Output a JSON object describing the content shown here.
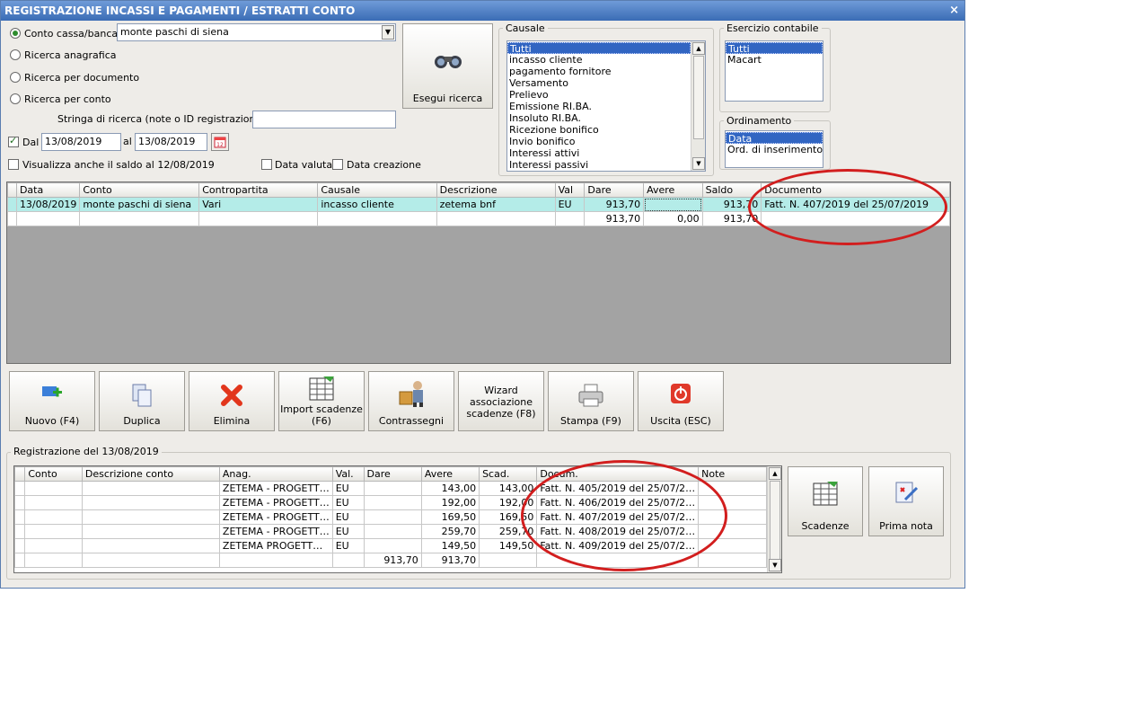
{
  "window": {
    "title": "REGISTRAZIONE INCASSI E PAGAMENTI / ESTRATTI CONTO",
    "close": "×"
  },
  "search": {
    "radio_conto": "Conto cassa/banca",
    "conto_value": "monte paschi di siena",
    "radio_anagrafica": "Ricerca anagrafica",
    "radio_documento": "Ricerca per documento",
    "radio_perconto": "Ricerca per conto",
    "stringa_label": "Stringa di ricerca (note o ID registrazione) :",
    "stringa_value": "",
    "dal_label": "Dal",
    "dal_value": "13/08/2019",
    "al_label": "al",
    "al_value": "13/08/2019",
    "saldo_label": "Visualizza anche il saldo al 12/08/2019",
    "data_valuta": "Data valuta",
    "data_creazione": "Data creazione",
    "esegui": "Esegui ricerca"
  },
  "causale": {
    "title": "Causale",
    "items": [
      "Tutti",
      "incasso cliente",
      "pagamento fornitore",
      "Versamento",
      "Prelievo",
      "Emissione RI.BA.",
      "Insoluto RI.BA.",
      "Ricezione bonifico",
      "Invio bonifico",
      "Interessi attivi",
      "Interessi passivi"
    ]
  },
  "esercizio": {
    "title": "Esercizio contabile",
    "items": [
      "Tutti",
      "Macart"
    ]
  },
  "ordinamento": {
    "title": "Ordinamento",
    "items": [
      "Data",
      "Ord. di inserimento"
    ]
  },
  "main_grid": {
    "headers": [
      "Data",
      "Conto",
      "Contropartita",
      "Causale",
      "Descrizione",
      "Val",
      "Dare",
      "Avere",
      "Saldo",
      "Documento"
    ],
    "rows": [
      [
        "13/08/2019",
        "monte paschi di siena",
        "Vari",
        "incasso cliente",
        "zetema bnf",
        "EU",
        "913,70",
        "",
        "913,70",
        "Fatt. N. 407/2019 del 25/07/2019"
      ]
    ],
    "totals": [
      "",
      "",
      "",
      "",
      "",
      "",
      "913,70",
      "0,00",
      "913,70",
      ""
    ]
  },
  "toolbar": {
    "nuovo": "Nuovo (F4)",
    "duplica": "Duplica",
    "elimina": "Elimina",
    "import": "Import scadenze (F6)",
    "contrassegni": "Contrassegni",
    "wizard": "Wizard associazione scadenze (F8)",
    "stampa": "Stampa (F9)",
    "uscita": "Uscita (ESC)"
  },
  "detail": {
    "title": "Registrazione del 13/08/2019",
    "headers": [
      "Conto",
      "Descrizione conto",
      "Anag.",
      "Val.",
      "Dare",
      "Avere",
      "Scad.",
      "Docum.",
      "Note"
    ],
    "rows": [
      [
        "",
        "",
        "ZETEMA - PROGETT…",
        "EU",
        "",
        "143,00",
        "143,00",
        "Fatt. N. 405/2019 del 25/07/2…",
        ""
      ],
      [
        "",
        "",
        "ZETEMA - PROGETT…",
        "EU",
        "",
        "192,00",
        "192,00",
        "Fatt. N. 406/2019 del 25/07/2…",
        ""
      ],
      [
        "",
        "",
        "ZETEMA - PROGETT…",
        "EU",
        "",
        "169,50",
        "169,50",
        "Fatt. N. 407/2019 del 25/07/2…",
        ""
      ],
      [
        "",
        "",
        "ZETEMA - PROGETT…",
        "EU",
        "",
        "259,70",
        "259,70",
        "Fatt. N. 408/2019 del 25/07/2…",
        ""
      ],
      [
        "",
        "",
        "ZETEMA PROGETT…",
        "EU",
        "",
        "149,50",
        "149,50",
        "Fatt. N. 409/2019 del 25/07/2…",
        ""
      ]
    ],
    "totals": [
      "",
      "",
      "",
      "",
      "913,70",
      "913,70",
      "",
      "",
      ""
    ],
    "scadenze": "Scadenze",
    "prima_nota": "Prima nota"
  },
  "colors": {
    "title_bar": "#3a6cb5",
    "highlight_row": "#b4ece8",
    "selection": "#3165c2",
    "annotation": "#d21e1e",
    "grid_bg": "#a3a3a3"
  }
}
